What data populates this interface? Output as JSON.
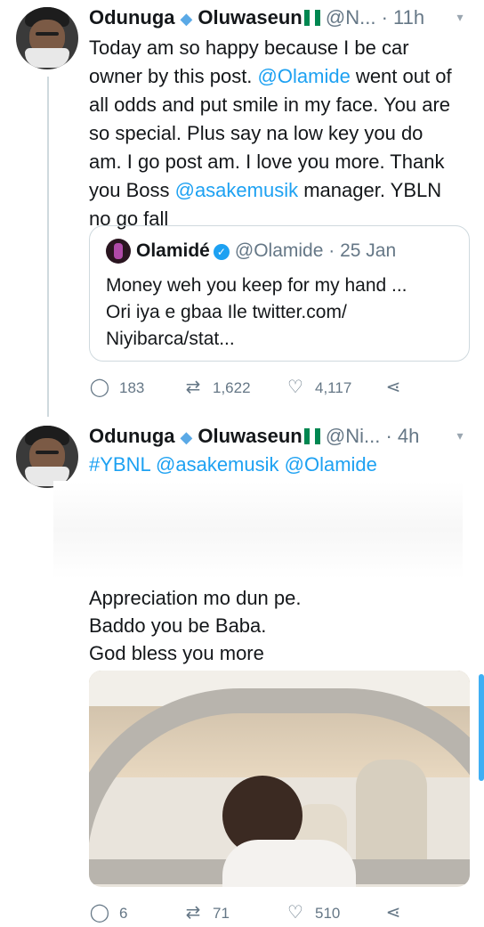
{
  "tweets": [
    {
      "name_first": "Odunuga",
      "name_second": "Oluwaseun",
      "handle": "@N...",
      "dot": "·",
      "time": "11h",
      "text_lines": [
        "Today am so happy because I be car",
        "owner by this post. @Olamide went out of",
        "all odds and put smile in my face. You are",
        "so special. Plus say na low key you do",
        "am. I go post am. I love you more. Thank",
        "you Boss @asakemusik manager. YBLN",
        "no go fall"
      ],
      "quote": {
        "name": "Olamidé",
        "handle": "@Olamide",
        "dot": "·",
        "date": "25 Jan",
        "text_lines": [
          "Money weh you keep for my hand ...",
          "Ori iya e gbaa Ile twitter.com/",
          "Niyibarca/stat..."
        ]
      },
      "replies": "183",
      "retweets": "1,622",
      "likes": "4,117"
    },
    {
      "name_first": "Odunuga",
      "name_second": "Oluwaseun",
      "handle": "@Ni...",
      "dot": "·",
      "time": "4h",
      "hashtag_line": "#YBNL @asakemusik @Olamide",
      "text_lines": [
        "Appreciation mo dun pe.",
        "Baddo you be Baba.",
        "God bless you more"
      ],
      "replies": "6",
      "retweets": "71",
      "likes": "510"
    }
  ],
  "colors": {
    "accent": "#1da1f2",
    "muted": "#657786",
    "flag_green": "#008751"
  },
  "icons": {
    "verified": "check-badge-icon",
    "diamond": "gem-icon",
    "flag": "nigeria-flag-icon",
    "reply": "reply-icon",
    "retweet": "retweet-icon",
    "like": "heart-icon",
    "share": "share-icon",
    "more": "chevron-down-icon"
  }
}
